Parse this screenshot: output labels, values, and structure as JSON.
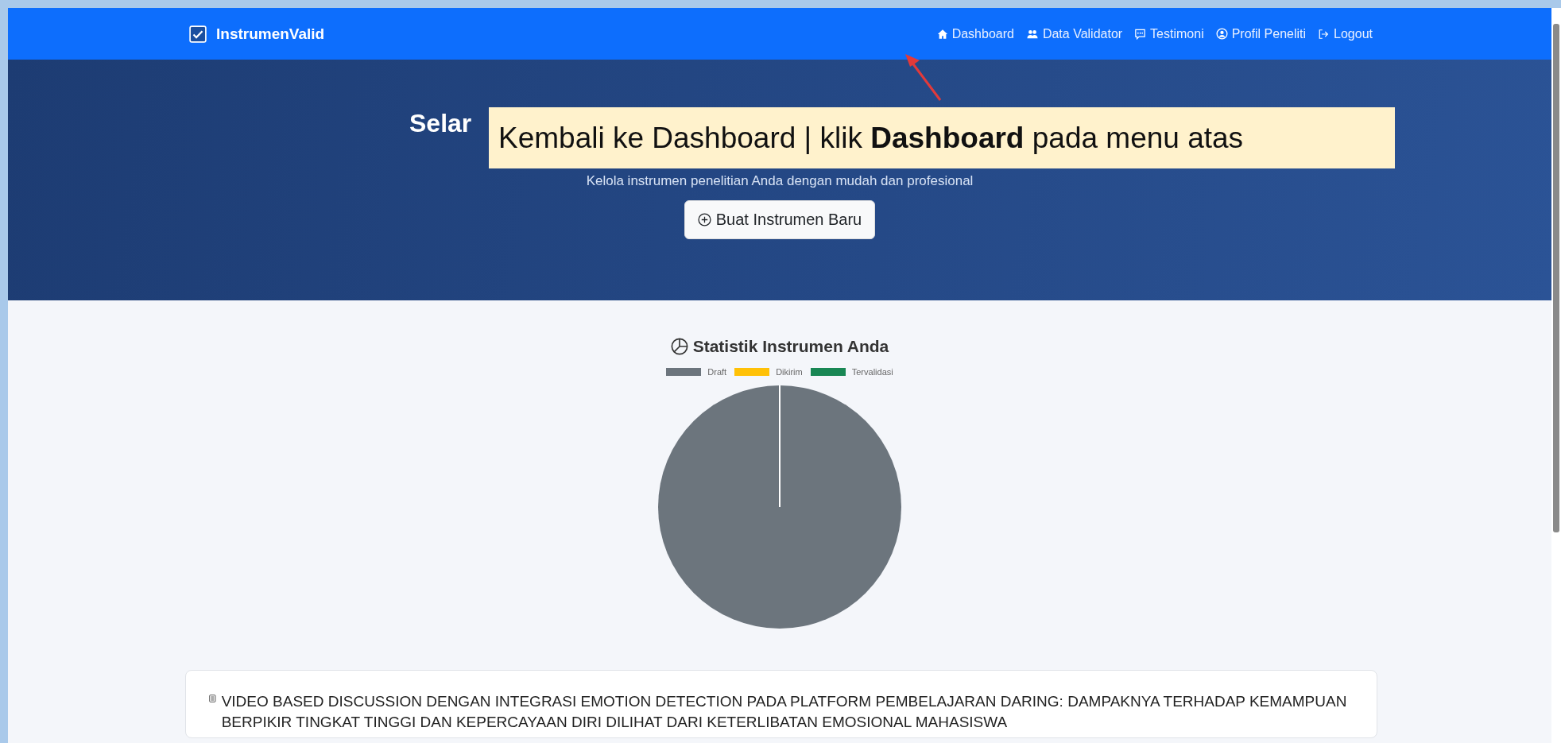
{
  "navbar": {
    "brand": "InstrumenValid",
    "links": [
      {
        "label": "Dashboard"
      },
      {
        "label": "Data Validator"
      },
      {
        "label": "Testimoni"
      },
      {
        "label": "Profil Peneliti"
      },
      {
        "label": "Logout"
      }
    ]
  },
  "hero": {
    "title": "Selar",
    "subtitle": "Kelola instrumen penelitian Anda dengan mudah dan profesional",
    "button": "Buat Instrumen Baru"
  },
  "callout": {
    "text": "Kembali ke Dashboard | klik **Dashboard** pada menu atas"
  },
  "stats": {
    "title": "Statistik Instrumen Anda",
    "legend": [
      {
        "label": "Draft",
        "color": "#6c757d"
      },
      {
        "label": "Dikirim",
        "color": "#ffc107"
      },
      {
        "label": "Tervalidasi",
        "color": "#198754"
      }
    ]
  },
  "instrument_card": {
    "title": "VIDEO BASED DISCUSSION DENGAN INTEGRASI EMOTION DETECTION PADA PLATFORM PEMBELAJARAN DARING: DAMPAKNYA TERHADAP KEMAMPUAN BERPIKIR TINGKAT TINGGI DAN KEPERCAYAAN DIRI DILIHAT DARI KETERLIBATAN EMOSIONAL MAHASISWA"
  }
}
